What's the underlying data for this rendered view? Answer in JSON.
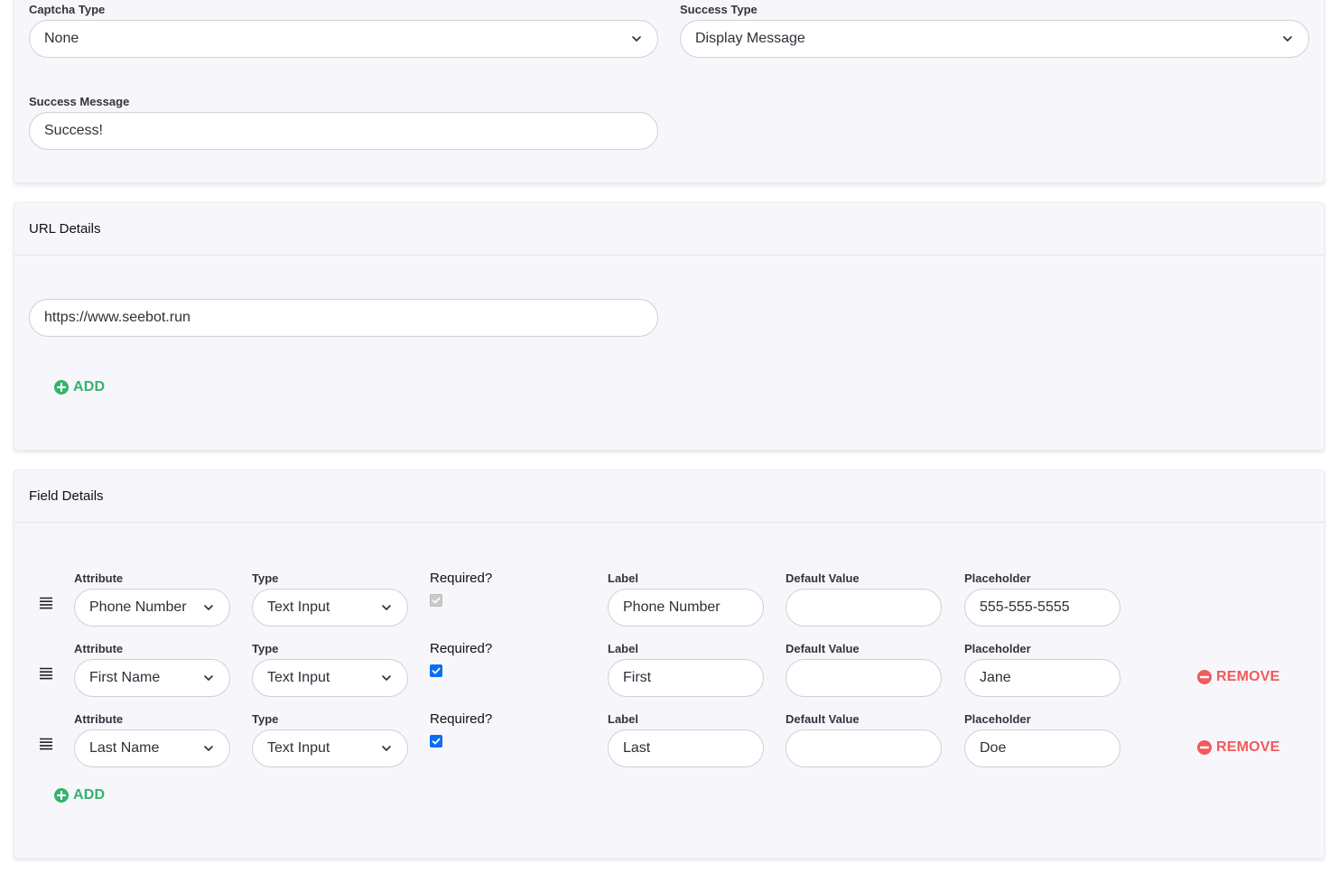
{
  "form_settings": {
    "captcha_type_label": "Captcha Type",
    "captcha_type_value": "None",
    "success_type_label": "Success Type",
    "success_type_value": "Display Message",
    "success_message_label": "Success Message",
    "success_message_value": "Success!"
  },
  "url_details": {
    "title": "URL Details",
    "url_value": "https://www.seebot.run",
    "add_label": "ADD"
  },
  "field_details": {
    "title": "Field Details",
    "column_labels": {
      "attribute": "Attribute",
      "type": "Type",
      "required": "Required?",
      "label": "Label",
      "default_value": "Default Value",
      "placeholder": "Placeholder"
    },
    "rows": [
      {
        "attribute": "Phone Number",
        "type": "Text Input",
        "required": true,
        "required_disabled": true,
        "label": "Phone Number",
        "default_value": "",
        "placeholder": "555-555-5555",
        "remove_label": ""
      },
      {
        "attribute": "First Name",
        "type": "Text Input",
        "required": true,
        "required_disabled": false,
        "label": "First",
        "default_value": "",
        "placeholder": "Jane",
        "remove_label": "REMOVE"
      },
      {
        "attribute": "Last Name",
        "type": "Text Input",
        "required": true,
        "required_disabled": false,
        "label": "Last",
        "default_value": "",
        "placeholder": "Doe",
        "remove_label": "REMOVE"
      }
    ],
    "add_label": "ADD"
  },
  "icons": {
    "select_arrow": "chevron-down-icon",
    "add": "plus-circle-icon",
    "remove": "minus-circle-icon",
    "drag": "drag-handle-icon",
    "check": "check-icon"
  },
  "colors": {
    "add_green": "#34b36b",
    "remove_red": "#ef5b5b",
    "checkbox_blue": "#0b6ef0",
    "card_background": "#f7f7fb"
  }
}
